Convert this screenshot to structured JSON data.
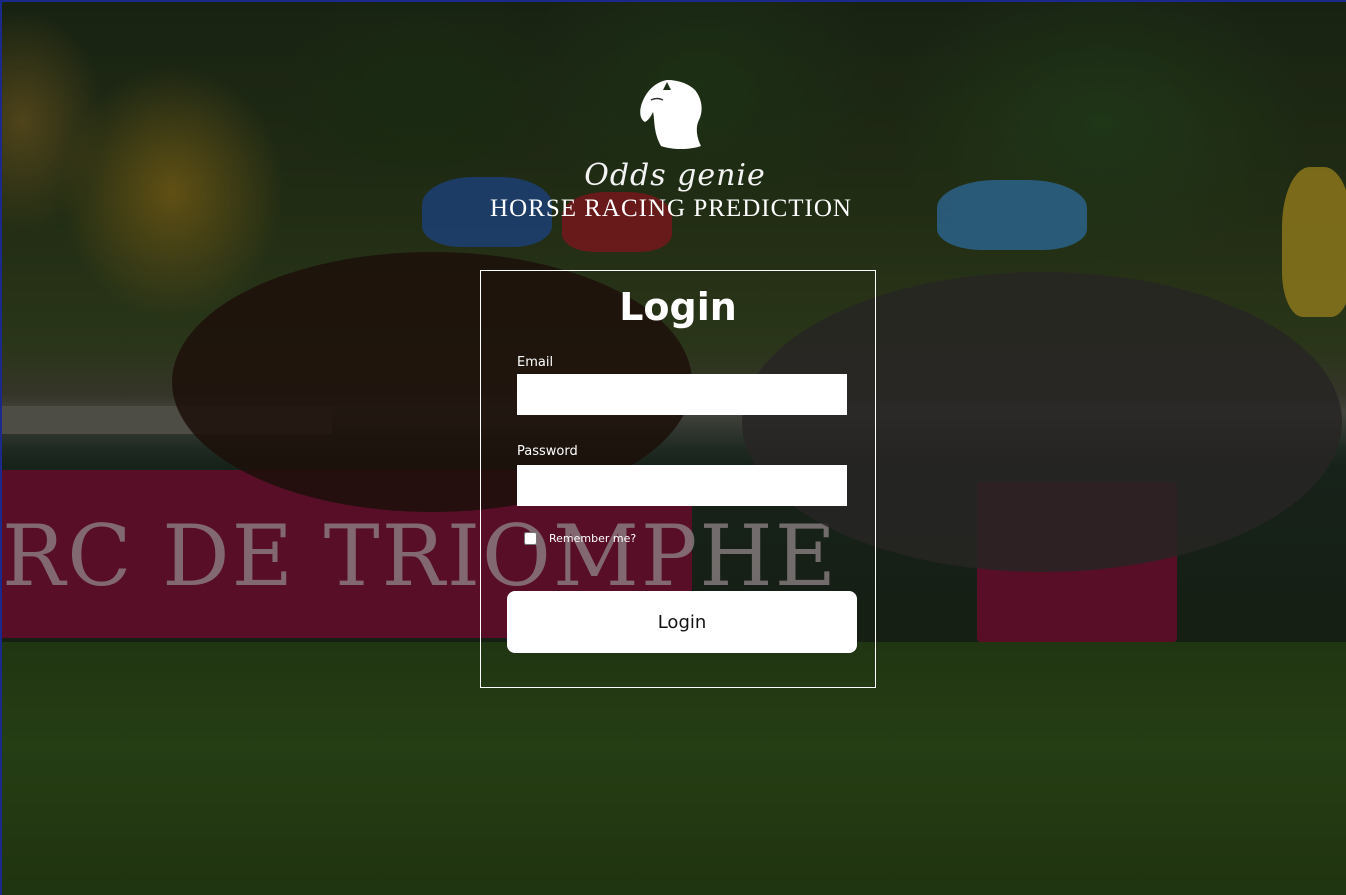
{
  "brand": {
    "script_name": "Odds genie",
    "tagline": "HORSE RACING PREDICTION",
    "logo_icon": "horse-head-icon"
  },
  "background": {
    "banner_text": "RC DE TRIOMPHE"
  },
  "login": {
    "title": "Login",
    "email_label": "Email",
    "email_value": "",
    "password_label": "Password",
    "password_value": "",
    "remember_label": "Remember me?",
    "remember_checked": false,
    "submit_label": "Login"
  },
  "colors": {
    "page_border": "#1b2a8a",
    "card_border": "#ffffff",
    "button_bg": "#ffffff",
    "checkbox_border": "#1f2a9c"
  }
}
